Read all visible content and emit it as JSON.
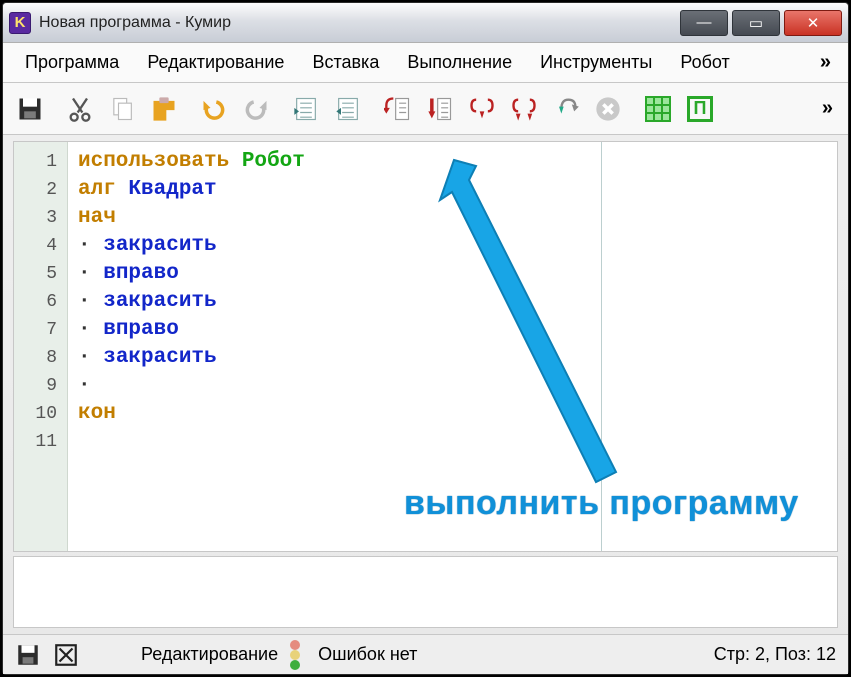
{
  "window": {
    "app_icon_letter": "K",
    "title": "Новая программа - Кумир"
  },
  "win_controls": {
    "minimize": "—",
    "maximize": "▭",
    "close": "✕"
  },
  "menubar": {
    "items": [
      "Программа",
      "Редактирование",
      "Вставка",
      "Выполнение",
      "Инструменты",
      "Робот"
    ],
    "overflow": "»"
  },
  "toolbar": {
    "buttons": [
      {
        "name": "save-icon"
      },
      {
        "name": "cut-icon"
      },
      {
        "name": "copy-icon"
      },
      {
        "name": "paste-icon"
      },
      {
        "name": "undo-icon"
      },
      {
        "name": "redo-icon"
      },
      {
        "name": "indent-icon"
      },
      {
        "name": "outdent-icon"
      },
      {
        "name": "step-into-icon"
      },
      {
        "name": "step-over-icon"
      },
      {
        "name": "step-loop1-icon"
      },
      {
        "name": "step-loop2-icon"
      },
      {
        "name": "run-icon"
      },
      {
        "name": "stop-icon"
      },
      {
        "name": "field-grid-icon"
      },
      {
        "name": "pi-icon"
      }
    ],
    "overflow": "»"
  },
  "editor": {
    "lines": [
      {
        "n": 1,
        "tokens": [
          {
            "t": "использовать ",
            "c": "tok-kw"
          },
          {
            "t": "Робот",
            "c": "tok-green"
          }
        ]
      },
      {
        "n": 2,
        "tokens": [
          {
            "t": "алг ",
            "c": "tok-kw"
          },
          {
            "t": "Квадрат",
            "c": "tok-blue"
          }
        ]
      },
      {
        "n": 3,
        "tokens": [
          {
            "t": "нач",
            "c": "tok-kw"
          }
        ]
      },
      {
        "n": 4,
        "tokens": [
          {
            "t": "· ",
            "c": "tok-dot"
          },
          {
            "t": "закрасить",
            "c": "tok-blue"
          }
        ]
      },
      {
        "n": 5,
        "tokens": [
          {
            "t": "· ",
            "c": "tok-dot"
          },
          {
            "t": "вправо",
            "c": "tok-blue"
          }
        ]
      },
      {
        "n": 6,
        "tokens": [
          {
            "t": "· ",
            "c": "tok-dot"
          },
          {
            "t": "закрасить",
            "c": "tok-blue"
          }
        ]
      },
      {
        "n": 7,
        "tokens": [
          {
            "t": "· ",
            "c": "tok-dot"
          },
          {
            "t": "вправо",
            "c": "tok-blue"
          }
        ]
      },
      {
        "n": 8,
        "tokens": [
          {
            "t": "· ",
            "c": "tok-dot"
          },
          {
            "t": "закрасить",
            "c": "tok-blue"
          }
        ]
      },
      {
        "n": 9,
        "tokens": [
          {
            "t": "·",
            "c": "tok-dot"
          }
        ]
      },
      {
        "n": 10,
        "tokens": [
          {
            "t": "кон",
            "c": "tok-kw"
          }
        ]
      },
      {
        "n": 11,
        "tokens": []
      }
    ]
  },
  "annotation": {
    "text": "выполнить программу"
  },
  "statusbar": {
    "mode": "Редактирование",
    "errors": "Ошибок нет",
    "cursor": "Стр: 2, Поз: 12"
  }
}
